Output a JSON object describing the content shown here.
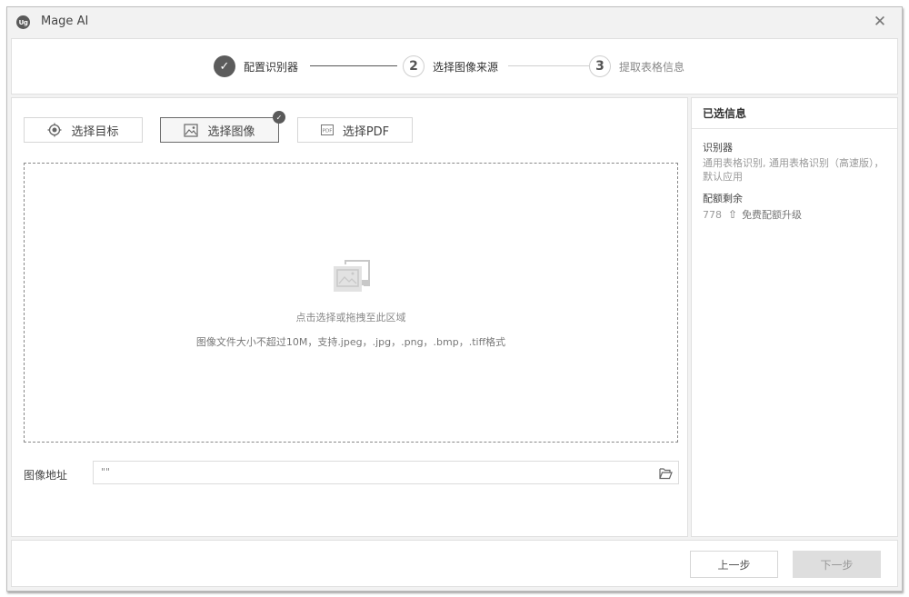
{
  "window": {
    "app_logo": "Ug",
    "title": "Mage AI",
    "close_glyph": "✕"
  },
  "steps": [
    {
      "number": "✓",
      "label": "配置识别器",
      "state": "done"
    },
    {
      "number": "2",
      "label": "选择图像来源",
      "state": "current"
    },
    {
      "number": "3",
      "label": "提取表格信息",
      "state": "pending"
    }
  ],
  "source_buttons": [
    {
      "label": "选择目标",
      "icon": "target-icon",
      "selected": false
    },
    {
      "label": "选择图像",
      "icon": "image-icon",
      "selected": true
    },
    {
      "label": "选择PDF",
      "icon": "pdf-icon",
      "selected": false
    }
  ],
  "selected_check": "✓",
  "dropzone": {
    "hint": "点击选择或拖拽至此区域",
    "requirements": "图像文件大小不超过10M，支持.jpeg，.jpg，.png，.bmp，.tiff格式"
  },
  "address": {
    "label": "图像地址",
    "value": "\"\""
  },
  "side_panel": {
    "title": "已选信息",
    "recognizer_label": "识别器",
    "recognizer_value": "通用表格识别, 通用表格识别（高速版），默认应用",
    "quota_label": "配额剩余",
    "quota_value": "778",
    "quota_arrow": "⇧",
    "upgrade_label": "免费配额升级"
  },
  "footer": {
    "prev_label": "上一步",
    "next_label": "下一步"
  },
  "colors": {
    "done_step": "#5c5c5c",
    "disabled_button": "#dedede",
    "window_bg": "#f2f2f2"
  }
}
